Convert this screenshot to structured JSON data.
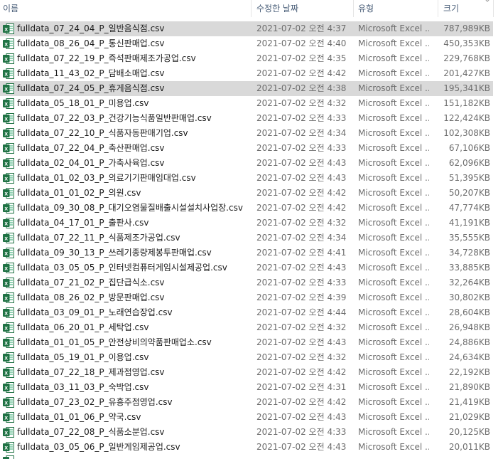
{
  "columns": {
    "name": "이름",
    "modified": "수정한 날짜",
    "type": "유형",
    "size": "크기"
  },
  "icon_colors": {
    "excel_green": "#1f7244",
    "excel_light": "#21a366"
  },
  "files": [
    {
      "name": "fulldata_07_24_04_P_일반음식점.csv",
      "modified": "2021-07-02 오전 4:37",
      "type": "Microsoft Excel ...",
      "size": "787,989KB",
      "selected": true
    },
    {
      "name": "fulldata_08_26_04_P_통신판매업.csv",
      "modified": "2021-07-02 오전 4:40",
      "type": "Microsoft Excel ...",
      "size": "450,353KB",
      "selected": false
    },
    {
      "name": "fulldata_07_22_19_P_즉석판매제조가공업.csv",
      "modified": "2021-07-02 오전 4:35",
      "type": "Microsoft Excel ...",
      "size": "229,768KB",
      "selected": false
    },
    {
      "name": "fulldata_11_43_02_P_담배소매업.csv",
      "modified": "2021-07-02 오전 4:42",
      "type": "Microsoft Excel ...",
      "size": "201,427KB",
      "selected": false
    },
    {
      "name": "fulldata_07_24_05_P_휴게음식점.csv",
      "modified": "2021-07-02 오전 4:38",
      "type": "Microsoft Excel ...",
      "size": "195,341KB",
      "selected": true
    },
    {
      "name": "fulldata_05_18_01_P_미용업.csv",
      "modified": "2021-07-02 오전 4:32",
      "type": "Microsoft Excel ...",
      "size": "151,182KB",
      "selected": false
    },
    {
      "name": "fulldata_07_22_03_P_건강기능식품일반판매업.csv",
      "modified": "2021-07-02 오전 4:33",
      "type": "Microsoft Excel ...",
      "size": "122,424KB",
      "selected": false
    },
    {
      "name": "fulldata_07_22_10_P_식품자동판매기업.csv",
      "modified": "2021-07-02 오전 4:34",
      "type": "Microsoft Excel ...",
      "size": "102,308KB",
      "selected": false
    },
    {
      "name": "fulldata_07_22_04_P_축산판매업.csv",
      "modified": "2021-07-02 오전 4:33",
      "type": "Microsoft Excel ...",
      "size": "67,106KB",
      "selected": false
    },
    {
      "name": "fulldata_02_04_01_P_가축사육업.csv",
      "modified": "2021-07-02 오전 4:43",
      "type": "Microsoft Excel ...",
      "size": "62,096KB",
      "selected": false
    },
    {
      "name": "fulldata_01_02_03_P_의료기기판매임대업.csv",
      "modified": "2021-07-02 오전 4:43",
      "type": "Microsoft Excel ...",
      "size": "51,395KB",
      "selected": false
    },
    {
      "name": "fulldata_01_01_02_P_의원.csv",
      "modified": "2021-07-02 오전 4:42",
      "type": "Microsoft Excel ...",
      "size": "50,207KB",
      "selected": false
    },
    {
      "name": "fulldata_09_30_08_P_대기오염물질배출시설설치사업장.csv",
      "modified": "2021-07-02 오전 4:42",
      "type": "Microsoft Excel ...",
      "size": "47,774KB",
      "selected": false
    },
    {
      "name": "fulldata_04_17_01_P_출판사.csv",
      "modified": "2021-07-02 오전 4:32",
      "type": "Microsoft Excel ...",
      "size": "41,191KB",
      "selected": false
    },
    {
      "name": "fulldata_07_22_11_P_식품제조가공업.csv",
      "modified": "2021-07-02 오전 4:34",
      "type": "Microsoft Excel ...",
      "size": "35,555KB",
      "selected": false
    },
    {
      "name": "fulldata_09_30_13_P_쓰레기종량제봉투판매업.csv",
      "modified": "2021-07-02 오전 4:41",
      "type": "Microsoft Excel ...",
      "size": "34,728KB",
      "selected": false
    },
    {
      "name": "fulldata_03_05_05_P_인터넷컴퓨터게임시설제공업.csv",
      "modified": "2021-07-02 오전 4:43",
      "type": "Microsoft Excel ...",
      "size": "33,885KB",
      "selected": false
    },
    {
      "name": "fulldata_07_21_02_P_집단급식소.csv",
      "modified": "2021-07-02 오전 4:33",
      "type": "Microsoft Excel ...",
      "size": "32,264KB",
      "selected": false
    },
    {
      "name": "fulldata_08_26_02_P_방문판매업.csv",
      "modified": "2021-07-02 오전 4:39",
      "type": "Microsoft Excel ...",
      "size": "30,802KB",
      "selected": false
    },
    {
      "name": "fulldata_03_09_01_P_노래연습장업.csv",
      "modified": "2021-07-02 오전 4:44",
      "type": "Microsoft Excel ...",
      "size": "28,604KB",
      "selected": false
    },
    {
      "name": "fulldata_06_20_01_P_세탁업.csv",
      "modified": "2021-07-02 오전 4:32",
      "type": "Microsoft Excel ...",
      "size": "26,948KB",
      "selected": false
    },
    {
      "name": "fulldata_01_01_05_P_안전상비의약품판매업소.csv",
      "modified": "2021-07-02 오전 4:43",
      "type": "Microsoft Excel ...",
      "size": "24,886KB",
      "selected": false
    },
    {
      "name": "fulldata_05_19_01_P_이용업.csv",
      "modified": "2021-07-02 오전 4:32",
      "type": "Microsoft Excel ...",
      "size": "24,634KB",
      "selected": false
    },
    {
      "name": "fulldata_07_22_18_P_제과점영업.csv",
      "modified": "2021-07-02 오전 4:42",
      "type": "Microsoft Excel ...",
      "size": "22,192KB",
      "selected": false
    },
    {
      "name": "fulldata_03_11_03_P_숙박업.csv",
      "modified": "2021-07-02 오전 4:31",
      "type": "Microsoft Excel ...",
      "size": "21,890KB",
      "selected": false
    },
    {
      "name": "fulldata_07_23_02_P_유흥주점영업.csv",
      "modified": "2021-07-02 오전 4:42",
      "type": "Microsoft Excel ...",
      "size": "21,419KB",
      "selected": false
    },
    {
      "name": "fulldata_01_01_06_P_약국.csv",
      "modified": "2021-07-02 오전 4:43",
      "type": "Microsoft Excel ...",
      "size": "21,029KB",
      "selected": false
    },
    {
      "name": "fulldata_07_22_08_P_식품소분업.csv",
      "modified": "2021-07-02 오전 4:33",
      "type": "Microsoft Excel ...",
      "size": "20,125KB",
      "selected": false
    },
    {
      "name": "fulldata_03_05_06_P_일반게임제공업.csv",
      "modified": "2021-07-02 오전 4:43",
      "type": "Microsoft Excel ...",
      "size": "20,011KB",
      "selected": false
    }
  ]
}
